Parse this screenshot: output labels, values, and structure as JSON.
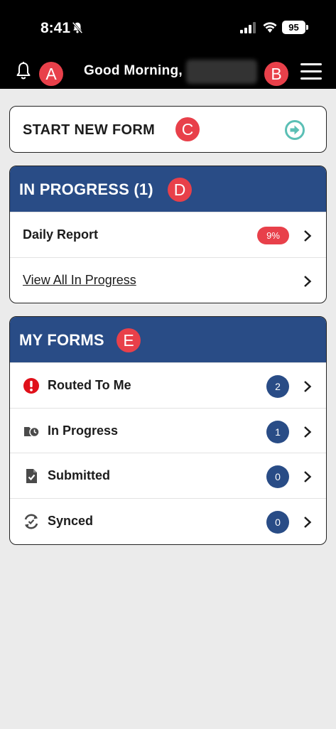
{
  "status_bar": {
    "time": "8:41",
    "battery": "95",
    "icons": [
      "bell-slash-icon",
      "signal-icon",
      "wifi-icon",
      "battery-icon"
    ]
  },
  "header": {
    "greeting": "Good Morning,",
    "icons": [
      "bell-icon",
      "hamburger-menu-icon"
    ]
  },
  "callouts": {
    "a": "A",
    "b": "B",
    "c": "C",
    "d": "D",
    "e": "E"
  },
  "start_form": {
    "label": "START NEW FORM",
    "icon": "arrow-right-circle-icon"
  },
  "in_progress": {
    "title": "IN PROGRESS (1)",
    "items": [
      {
        "label": "Daily Report",
        "badge": "9%"
      },
      {
        "label": "View All In Progress"
      }
    ]
  },
  "my_forms": {
    "title": "MY FORMS",
    "items": [
      {
        "label": "Routed To Me",
        "count": "2",
        "icon": "alert-circle-icon"
      },
      {
        "label": "In Progress",
        "count": "1",
        "icon": "form-clock-icon"
      },
      {
        "label": "Submitted",
        "count": "0",
        "icon": "document-check-icon"
      },
      {
        "label": "Synced",
        "count": "0",
        "icon": "sync-check-icon"
      }
    ]
  },
  "colors": {
    "header_bg": "#000000",
    "section_header": "#294c86",
    "callout": "#e8404a",
    "accent_teal": "#5bbfb5",
    "alert_red": "#e0101a",
    "page_bg": "#ebebeb"
  }
}
